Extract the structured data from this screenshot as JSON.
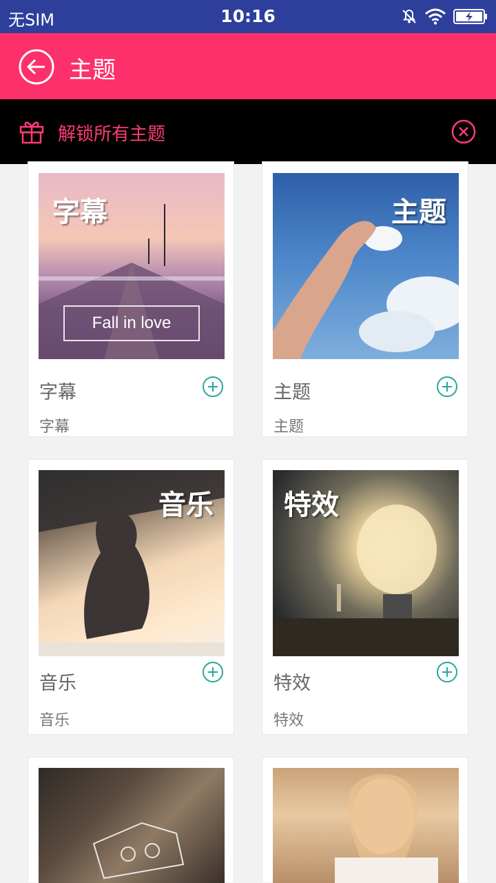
{
  "status": {
    "carrier": "无SIM",
    "time": "10:16"
  },
  "app_bar": {
    "title": "主题"
  },
  "promo": {
    "text": "解锁所有主题"
  },
  "cards": [
    {
      "name": "字幕",
      "desc": "字幕",
      "overlay": "字幕",
      "caption": "Fall in love"
    },
    {
      "name": "主题",
      "desc": "主题",
      "overlay": "主题"
    },
    {
      "name": "音乐",
      "desc": "音乐",
      "overlay": "音乐"
    },
    {
      "name": "特效",
      "desc": "特效",
      "overlay": "特效"
    }
  ],
  "colors": {
    "status_bar": "#2d3f9b",
    "app_bar": "#fc316c",
    "promo_bg": "#000000",
    "promo_accent": "#ff3b74",
    "add_icon": "#26a69a"
  }
}
